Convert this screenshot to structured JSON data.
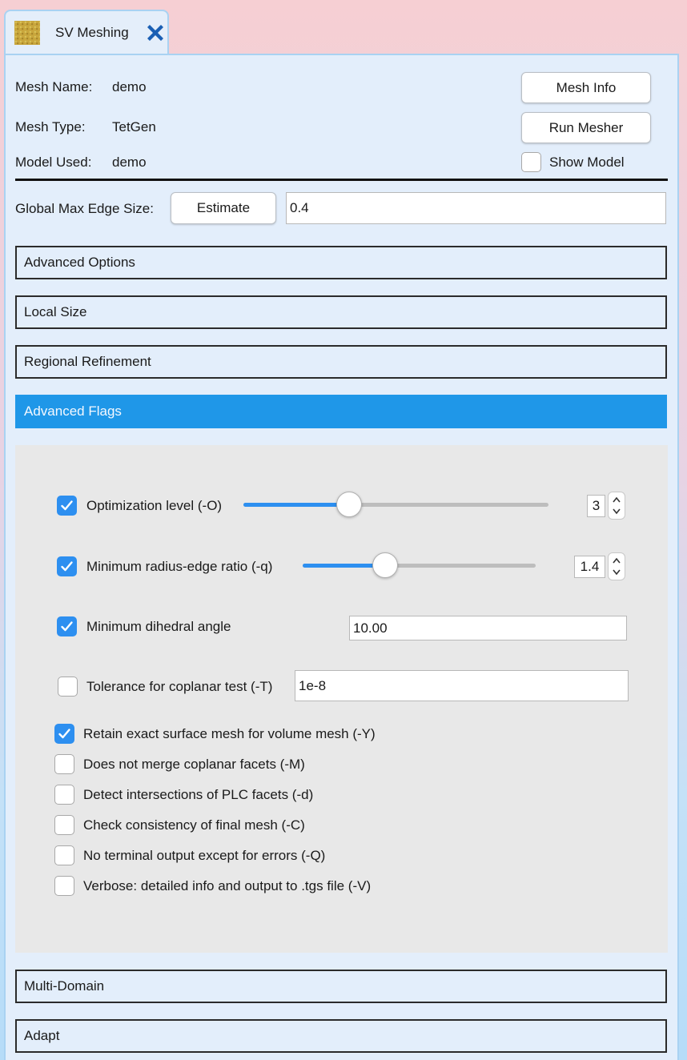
{
  "tab": {
    "label": "SV Meshing"
  },
  "info": {
    "mesh_name_label": "Mesh Name:",
    "mesh_name_value": "demo",
    "mesh_type_label": "Mesh Type:",
    "mesh_type_value": "TetGen",
    "model_used_label": "Model Used:",
    "model_used_value": "demo"
  },
  "buttons": {
    "mesh_info": "Mesh Info",
    "run_mesher": "Run Mesher",
    "show_model": "Show Model",
    "show_model_checked": false
  },
  "global_edge": {
    "label": "Global Max Edge Size:",
    "estimate_button": "Estimate",
    "value": "0.4"
  },
  "sections": {
    "advanced_options": "Advanced Options",
    "local_size": "Local Size",
    "regional_refinement": "Regional Refinement",
    "advanced_flags": "Advanced Flags",
    "multi_domain": "Multi-Domain",
    "adapt": "Adapt"
  },
  "flags": {
    "optimization": {
      "label": "Optimization level (-O)",
      "checked": true,
      "value": "3",
      "slider_fraction": 0.346
    },
    "radius_edge": {
      "label": "Minimum radius-edge ratio (-q)",
      "checked": true,
      "value": "1.4",
      "slider_fraction": 0.353
    },
    "dihedral": {
      "label": "Minimum dihedral angle",
      "checked": true,
      "value": "10.00"
    },
    "coplanar": {
      "label": "Tolerance for coplanar test (-T)",
      "checked": false,
      "value": "1e-8"
    },
    "options": [
      {
        "label": "Retain exact surface mesh for volume mesh (-Y)",
        "checked": true
      },
      {
        "label": "Does not merge coplanar facets (-M)",
        "checked": false
      },
      {
        "label": "Detect intersections of PLC facets (-d)",
        "checked": false
      },
      {
        "label": "Check consistency of final mesh (-C)",
        "checked": false
      },
      {
        "label": "No terminal output except for errors (-Q)",
        "checked": false
      },
      {
        "label": "Verbose: detailed info and output to .tgs file (-V)",
        "checked": false
      }
    ]
  },
  "colors": {
    "accent": "#2d8ff0",
    "section_active": "#1f97e8",
    "panel": "#e3eefb",
    "flags_bg": "#e8e8e8",
    "close_icon": "#1a5fb4"
  }
}
